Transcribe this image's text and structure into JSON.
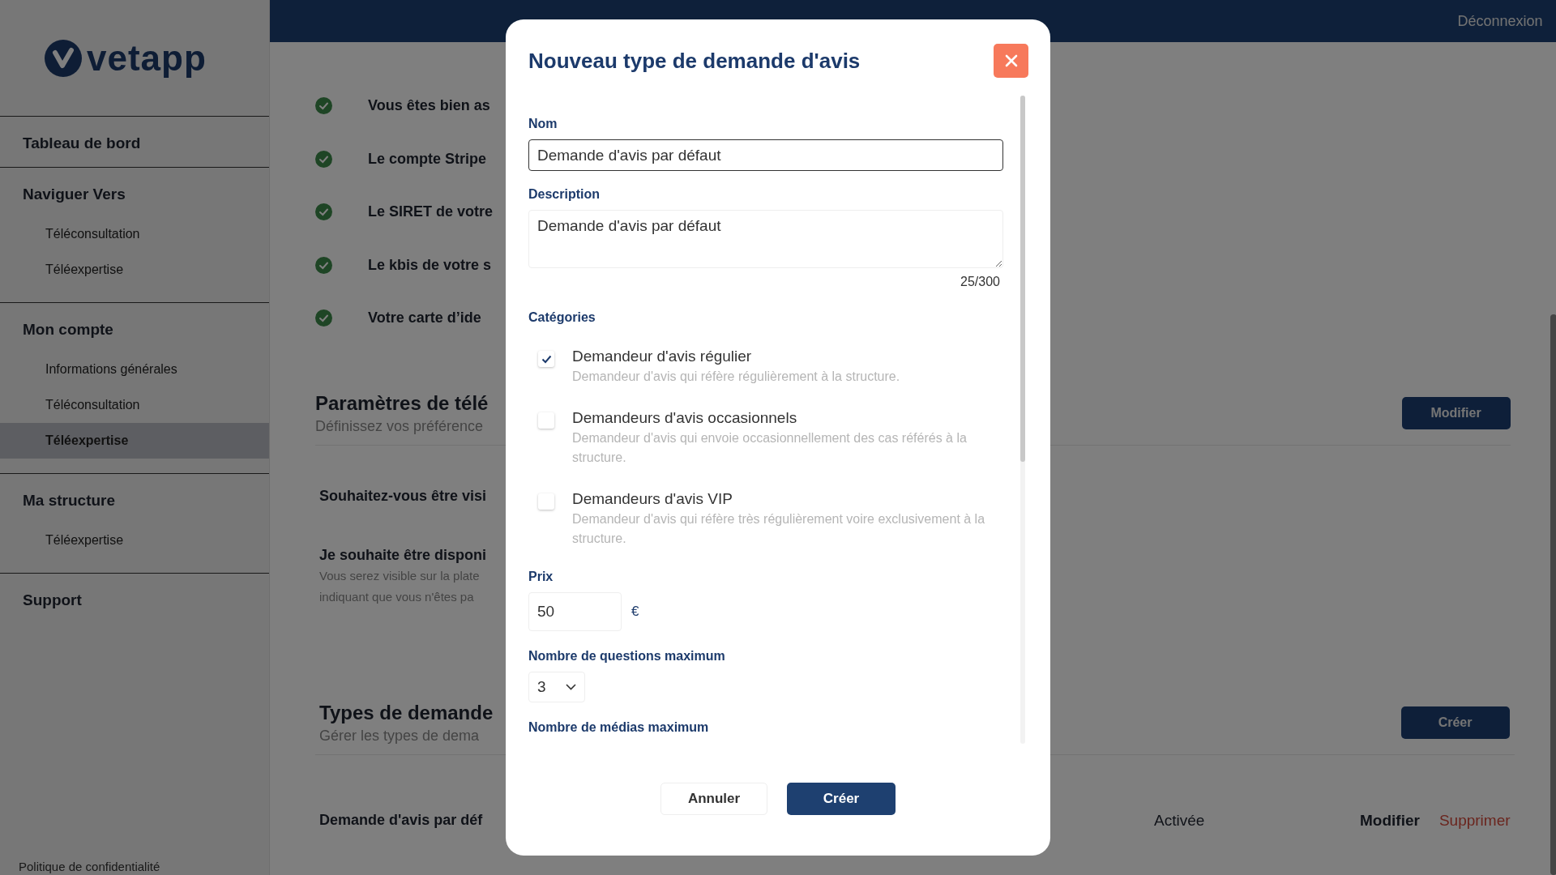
{
  "sidebar": {
    "logo": "vetapp",
    "sections": [
      {
        "title": "Tableau de bord"
      },
      {
        "title": "Naviguer Vers",
        "items": [
          {
            "label": "Téléconsultation",
            "selected": false
          },
          {
            "label": "Téléexpertise",
            "selected": false
          }
        ]
      },
      {
        "title": "Mon compte",
        "items": [
          {
            "label": "Informations générales",
            "selected": false
          },
          {
            "label": "Téléconsultation",
            "selected": false
          },
          {
            "label": "Téléexpertise",
            "selected": true
          }
        ]
      },
      {
        "title": "Ma structure",
        "items": [
          {
            "label": "Téléexpertise",
            "selected": false
          }
        ]
      },
      {
        "title": "Support"
      }
    ],
    "footer_link": "Politique de confidentialité"
  },
  "header": {
    "logout": "Déconnexion"
  },
  "checklist": [
    {
      "text": "Vous êtes bien as",
      "done": true
    },
    {
      "text": "Le compte Stripe",
      "done": true
    },
    {
      "text": "Le SIRET de votre",
      "done": true
    },
    {
      "text": "Le kbis de votre s",
      "done": true
    },
    {
      "text": "Votre carte d’ide",
      "done": true
    }
  ],
  "settings_section": {
    "title": "Paramètres de télé",
    "subtitle": "Définissez vos préférence",
    "button": "Modifier",
    "questions": [
      {
        "title": "Souhaitez-vous être visi"
      },
      {
        "title": "Je souhaite être disponi",
        "description_lines": [
          "Vous serez visible sur la plate",
          "indiquant que vous n'êtes pa"
        ]
      }
    ]
  },
  "types_section": {
    "title": "Types de demande",
    "subtitle": "Gérer les types de dema",
    "button": "Créer",
    "rows": [
      {
        "name": "Demande d'avis par déf",
        "status": "Activée",
        "edit": "Modifier",
        "delete": "Supprimer"
      }
    ]
  },
  "modal": {
    "title": "Nouveau type de demande d'avis",
    "name_field": {
      "label": "Nom",
      "value": "Demande d'avis par défaut"
    },
    "description_field": {
      "label": "Description",
      "value": "Demande d'avis par défaut",
      "counter": "25/300"
    },
    "categories": {
      "label": "Catégories",
      "options": [
        {
          "title": "Demandeur d'avis régulier",
          "description": "Demandeur d'avis qui réfère régulièrement à la structure.",
          "checked": true
        },
        {
          "title": "Demandeurs d'avis occasionnels",
          "description": "Demandeur d'avis qui envoie occasionnellement des cas référés à la structure.",
          "checked": false
        },
        {
          "title": "Demandeurs d'avis VIP",
          "description": "Demandeur d'avis qui réfère très régulièrement voire exclusivement à la structure.",
          "checked": false
        }
      ]
    },
    "price_field": {
      "label": "Prix",
      "value": "50",
      "currency": "€"
    },
    "max_questions": {
      "label": "Nombre de questions maximum",
      "value": "3"
    },
    "max_media": {
      "label": "Nombre de médias maximum"
    },
    "cancel_button": "Annuler",
    "create_button": "Créer"
  }
}
